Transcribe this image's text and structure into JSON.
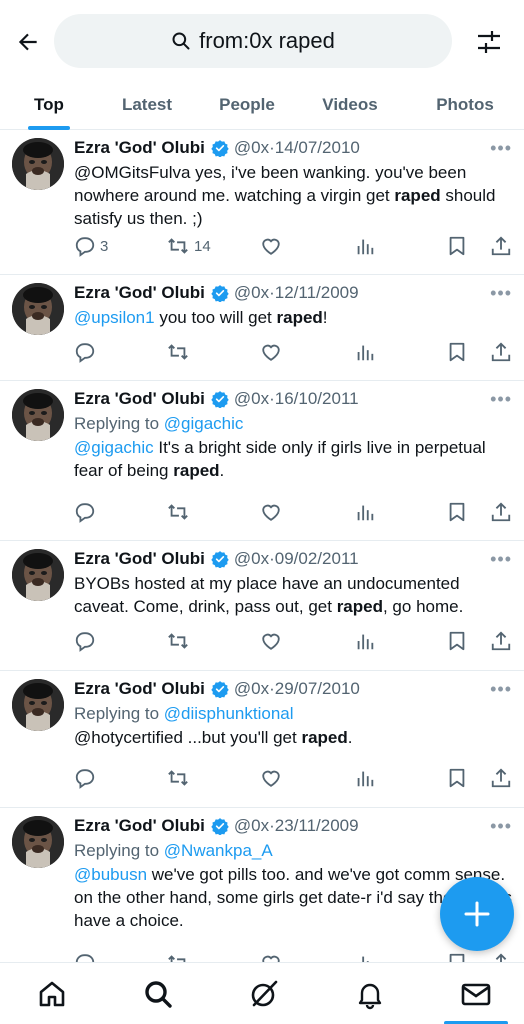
{
  "search": {
    "query": "from:0x raped"
  },
  "tabs": [
    {
      "label": "Top",
      "active": true
    },
    {
      "label": "Latest",
      "active": false
    },
    {
      "label": "People",
      "active": false
    },
    {
      "label": "Videos",
      "active": false
    },
    {
      "label": "Photos",
      "active": false
    }
  ],
  "author": {
    "name": "Ezra 'God' Olubi",
    "handle": "@0x"
  },
  "tweets": [
    {
      "date": "14/07/2010",
      "replying_to": "",
      "text_parts": [
        {
          "t": "@OMGitsFulva yes, i've been wanking. you've been nowhere around me. watching a virgin get "
        },
        {
          "t": "raped",
          "bold": true
        },
        {
          "t": " should satisfy us then. ;)"
        }
      ],
      "replies": "3",
      "retweets": "14",
      "likes": ""
    },
    {
      "date": "12/11/2009",
      "replying_to": "",
      "text_parts": [
        {
          "t": "@upsilon1",
          "mention": true
        },
        {
          "t": " you too will get "
        },
        {
          "t": "raped",
          "bold": true
        },
        {
          "t": "!"
        }
      ],
      "replies": "",
      "retweets": "",
      "likes": ""
    },
    {
      "date": "16/10/2011",
      "replying_to": "@gigachic",
      "text_parts": [
        {
          "t": "@gigachic",
          "mention": true
        },
        {
          "t": " It's a bright side only if girls live in perpetual fear of being "
        },
        {
          "t": "raped",
          "bold": true
        },
        {
          "t": "."
        }
      ],
      "replies": "",
      "retweets": "",
      "likes": ""
    },
    {
      "date": "09/02/2011",
      "replying_to": "",
      "text_parts": [
        {
          "t": "BYOBs hosted at my place have an undocumented caveat. Come, drink, pass out, get "
        },
        {
          "t": "raped",
          "bold": true
        },
        {
          "t": ", go home."
        }
      ],
      "replies": "",
      "retweets": "",
      "likes": ""
    },
    {
      "date": "29/07/2010",
      "replying_to": "@diisphunktional",
      "text_parts": [
        {
          "t": "@hotycertified ...but you'll get "
        },
        {
          "t": "raped",
          "bold": true
        },
        {
          "t": "."
        }
      ],
      "replies": "",
      "retweets": "",
      "likes": ""
    },
    {
      "date": "23/11/2009",
      "replying_to": "@Nwankpa_A",
      "text_parts": [
        {
          "t": "@bubusn",
          "mention": true
        },
        {
          "t": " we've got pills too. and we've got comm sense. on the other hand, some girls get date-r i'd say those ones have a choice."
        }
      ],
      "replies": "",
      "retweets": "",
      "likes": ""
    }
  ],
  "labels": {
    "replying_to_prefix": "Replying to ",
    "dot": " · "
  },
  "icons": {
    "back": "arrow-left-icon",
    "search": "search-icon",
    "filter": "sliders-icon",
    "verified": "verified-badge-icon",
    "more": "more-dots-icon",
    "reply": "reply-icon",
    "retweet": "retweet-icon",
    "like": "heart-icon",
    "views": "analytics-icon",
    "bookmark": "bookmark-icon",
    "share": "share-icon",
    "compose": "plus-icon",
    "home": "home-icon",
    "explore": "search-icon",
    "grok": "grok-icon",
    "notifications": "bell-icon",
    "messages": "mail-icon"
  },
  "colors": {
    "accent": "#1d9bf0",
    "text": "#0f1419",
    "muted": "#536471"
  }
}
